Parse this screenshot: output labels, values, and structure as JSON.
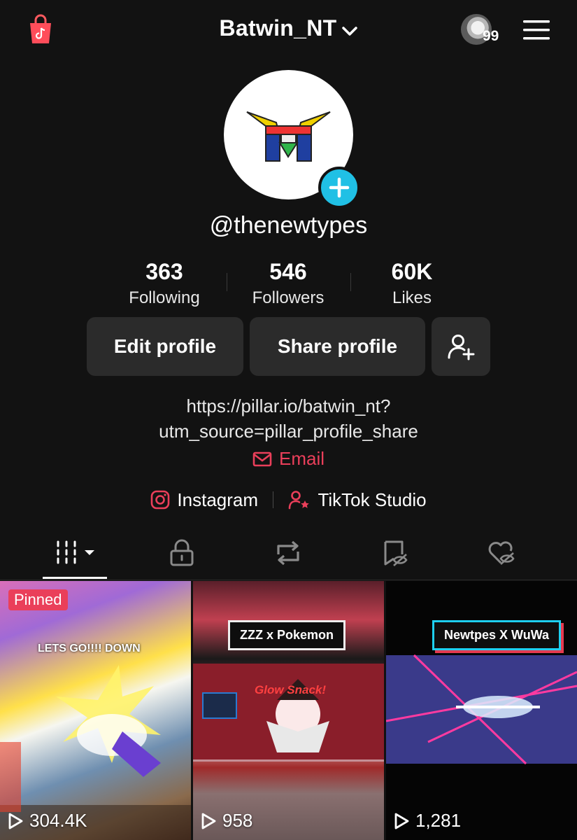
{
  "header": {
    "username": "Batwin_NT",
    "notification_count": "99"
  },
  "profile": {
    "handle": "@thenewtypes",
    "stats": [
      {
        "value": "363",
        "label": "Following"
      },
      {
        "value": "546",
        "label": "Followers"
      },
      {
        "value": "60K",
        "label": "Likes"
      }
    ],
    "buttons": {
      "edit": "Edit profile",
      "share": "Share profile"
    },
    "bio_link_line1": "https://pillar.io/batwin_nt?",
    "bio_link_line2": "utm_source=pillar_profile_share",
    "email_label": "Email",
    "links": [
      {
        "label": "Instagram",
        "icon": "instagram-icon"
      },
      {
        "label": "TikTok Studio",
        "icon": "person-star-icon"
      }
    ]
  },
  "tabs": [
    {
      "icon": "grid-icon",
      "active": true
    },
    {
      "icon": "lock-icon",
      "active": false
    },
    {
      "icon": "repost-icon",
      "active": false
    },
    {
      "icon": "bookmark-hidden-icon",
      "active": false
    },
    {
      "icon": "liked-hidden-icon",
      "active": false
    }
  ],
  "videos": [
    {
      "views": "304.4K",
      "pinned_label": "Pinned",
      "overlay_text": "LETS GO!!!! DOWN"
    },
    {
      "views": "958",
      "overlay_text": "ZZZ x Pokemon",
      "sub_text": "Glow Snack!"
    },
    {
      "views": "1,281",
      "overlay_text": "Newtpes X WuWa"
    }
  ],
  "colors": {
    "background": "#121212",
    "accent_red": "#ea3f5a",
    "accent_cyan": "#20c0e5",
    "button_bg": "#2b2b2b"
  }
}
